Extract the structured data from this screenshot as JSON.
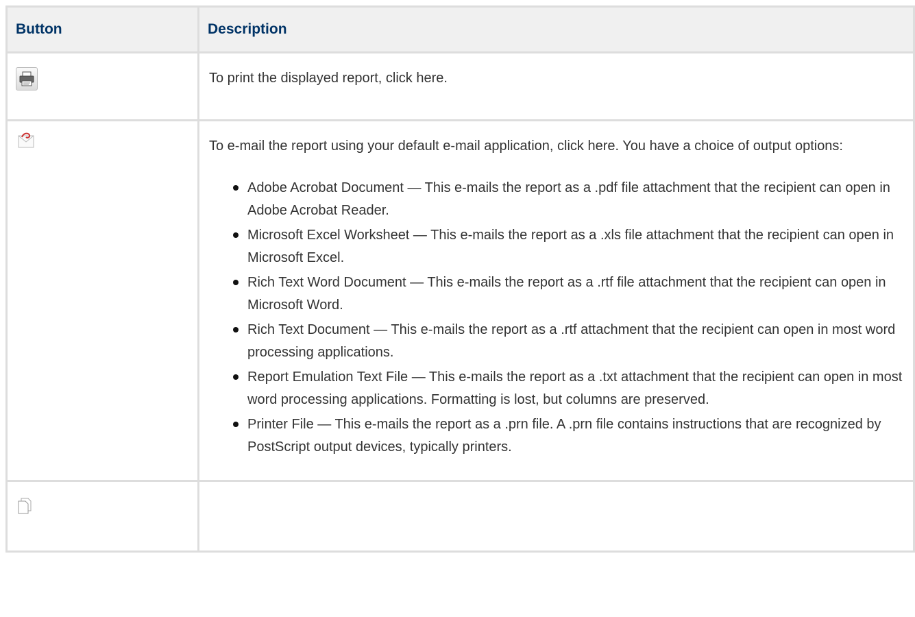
{
  "table": {
    "headers": {
      "button": "Button",
      "description": "Description"
    },
    "rows": [
      {
        "icon": "printer-icon",
        "description": "To print the displayed report, click here."
      },
      {
        "icon": "email-icon",
        "description": "To e-mail the report using your default e-mail application, click here. You have a choice of output options:",
        "options": [
          "Adobe Acrobat Document — This e-mails the report as a .pdf file attachment that the recipient can open in Adobe Acrobat Reader.",
          "Microsoft Excel Worksheet — This e-mails the report as a .xls file attachment that the recipient can open in Microsoft Excel.",
          "Rich Text Word Document — This e-mails the report as a .rtf file attachment that the recipient can open in Microsoft Word.",
          "Rich Text Document — This e-mails the report as a .rtf attachment that the recipient can open in most word processing applications.",
          "Report Emulation Text File — This e-mails the report as a .txt attachment that the recipient can open in most word processing applications. Formatting is lost, but columns are preserved.",
          "Printer File — This e-mails the report as a .prn file. A .prn file contains instructions that are recognized by PostScript output devices, typically printers."
        ]
      },
      {
        "icon": "copy-icon",
        "description": ""
      }
    ]
  },
  "colors": {
    "header_text": "#003366",
    "header_bg": "#f0f0f0",
    "border": "#dddddd",
    "body_text": "#333333",
    "email_icon_accent": "#cc3333"
  }
}
